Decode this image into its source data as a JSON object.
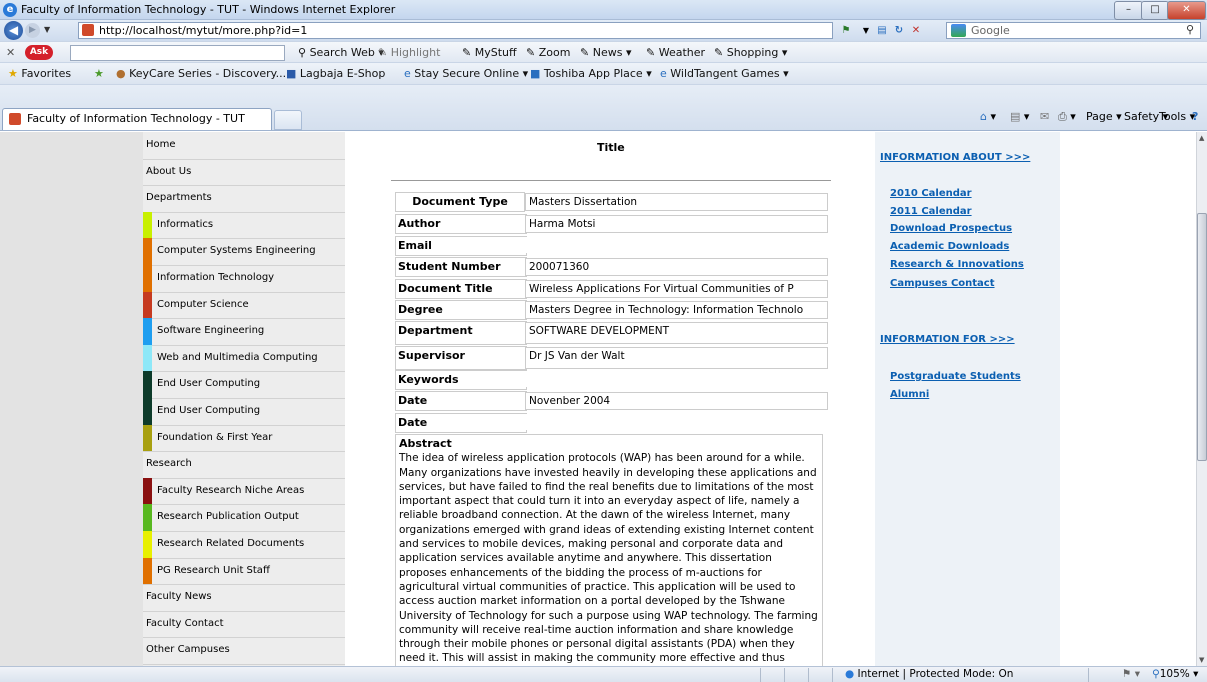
{
  "window": {
    "title": "Faculty of Information Technology - TUT - Windows Internet Explorer"
  },
  "address": {
    "url": "http://localhost/mytut/more.php?id=1"
  },
  "search": {
    "placeholder": "Google"
  },
  "ask_toolbar": {
    "items": [
      "Search Web",
      "Highlight",
      "MyStuff",
      "Zoom",
      "News",
      "Weather",
      "Shopping"
    ]
  },
  "favorites_bar": {
    "favorites_label": "Favorites",
    "items": [
      "KeyCare Series - Discovery...",
      "Lagbaja E-Shop",
      "Stay Secure Online",
      "Toshiba App Place",
      "WildTangent Games"
    ]
  },
  "tab": {
    "label": "Faculty of Information Technology - TUT"
  },
  "command_bar": {
    "page": "Page",
    "safety": "Safety",
    "tools": "Tools"
  },
  "sidebar": {
    "items": [
      {
        "label": "Home",
        "sub": false,
        "color": ""
      },
      {
        "label": "About Us",
        "sub": false,
        "color": ""
      },
      {
        "label": "Departments",
        "sub": false,
        "color": ""
      },
      {
        "label": "Informatics",
        "sub": true,
        "color": "#c8f000"
      },
      {
        "label": "Computer Systems Engineering",
        "sub": true,
        "color": "#e07000"
      },
      {
        "label": "Information Technology",
        "sub": true,
        "color": "#e07000"
      },
      {
        "label": "Computer Science",
        "sub": true,
        "color": "#c63a20"
      },
      {
        "label": "Software Engineering",
        "sub": true,
        "color": "#1e9ef0"
      },
      {
        "label": "Web and Multimedia Computing",
        "sub": true,
        "color": "#8ee8f8"
      },
      {
        "label": "End User Computing",
        "sub": true,
        "color": "#0d3b2a"
      },
      {
        "label": "End User Computing",
        "sub": true,
        "color": "#0d3b2a"
      },
      {
        "label": "Foundation & First Year",
        "sub": true,
        "color": "#a8a010"
      },
      {
        "label": "Research",
        "sub": false,
        "color": ""
      },
      {
        "label": "Faculty Research Niche Areas",
        "sub": true,
        "color": "#8a1010"
      },
      {
        "label": "Research Publication Output",
        "sub": true,
        "color": "#58b820"
      },
      {
        "label": "Research Related Documents",
        "sub": true,
        "color": "#e8f000"
      },
      {
        "label": "PG Research Unit Staff",
        "sub": true,
        "color": "#e07000"
      },
      {
        "label": "Faculty News",
        "sub": false,
        "color": ""
      },
      {
        "label": "Faculty Contact",
        "sub": false,
        "color": ""
      },
      {
        "label": "Other Campuses",
        "sub": false,
        "color": ""
      }
    ]
  },
  "main": {
    "heading": "Title",
    "fields": [
      {
        "label": "Document Type",
        "value": "Masters Dissertation"
      },
      {
        "label": "Author",
        "value": "Harma Motsi"
      },
      {
        "label": "Email",
        "value": ""
      },
      {
        "label": "Student Number",
        "value": "200071360"
      },
      {
        "label": "Document Title",
        "value": "Wireless Applications For Virtual Communities of P"
      },
      {
        "label": "Degree",
        "value": "Masters Degree in Technology: Information Technolo"
      },
      {
        "label": "Department",
        "value": "SOFTWARE DEVELOPMENT"
      },
      {
        "label": "Supervisor",
        "value": "Dr JS Van der Walt"
      },
      {
        "label": "Keywords",
        "value": ""
      },
      {
        "label": "Date",
        "value": "Novenber 2004"
      },
      {
        "label": "Date",
        "value": ""
      }
    ],
    "abstract_heading": "Abstract",
    "abstract_text": "The idea of wireless application protocols (WAP) has been around for a while. Many organizations have invested heavily in developing these applications and services, but have failed to find the real benefits due to limitations of the most important aspect that could turn it into an everyday aspect of life, namely a reliable broadband connection. At the dawn of the wireless Internet, many organizations emerged with grand ideas of extending existing Internet content and services to mobile devices, making personal and corporate data and application services available anytime and anywhere. This dissertation proposes enhancements of the bidding the process of m-auctions for agricultural virtual communities of practice. This application will be used to access auction market information on a portal developed by the Tshwane University of Technology for such a purpose using WAP technology. The farming community will receive real-time auction information and share knowledge through their mobile phones or personal digital assistants (PDA) when they need it. This will assist in making the community more effective and thus improving productivity. For example, knowledge of real market prices will put the"
  },
  "right": {
    "info_about": "INFORMATION ABOUT >>>",
    "about_links": [
      "2010 Calendar",
      "2011 Calendar",
      "Download Prospectus",
      "Academic Downloads",
      "Research & Innovations",
      "Campuses Contact"
    ],
    "info_for": "INFORMATION FOR >>>",
    "for_links": [
      "Postgraduate Students",
      "Alumni"
    ]
  },
  "status": {
    "zone": "Internet | Protected Mode: On",
    "zoom": "105%"
  }
}
